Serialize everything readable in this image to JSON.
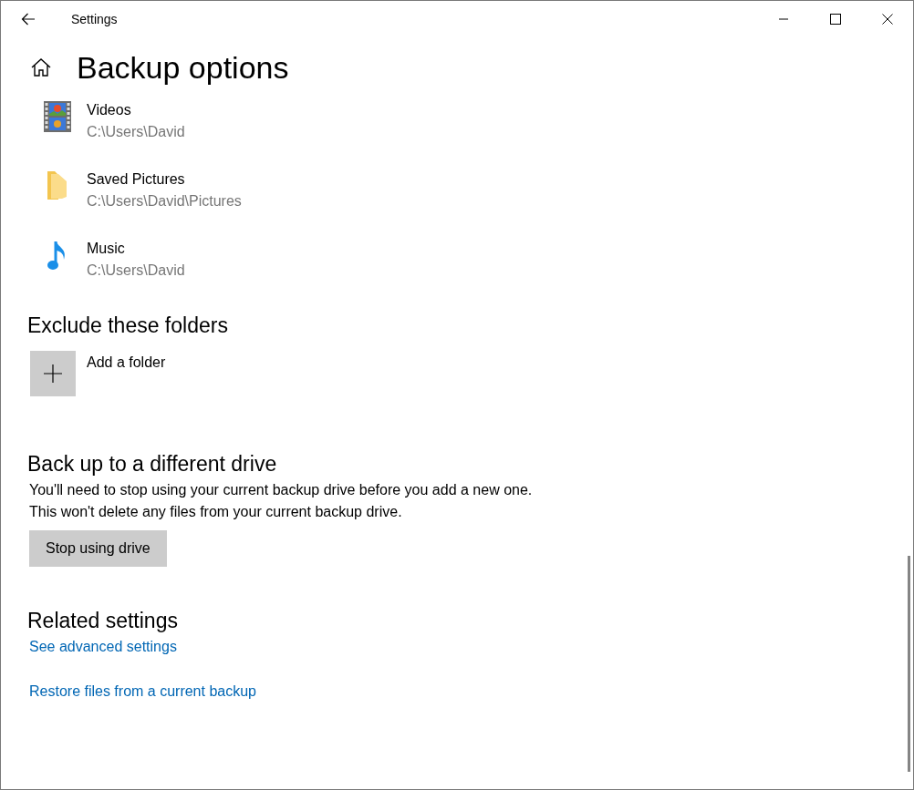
{
  "window": {
    "title": "Settings"
  },
  "page_title": "Backup options",
  "folders": [
    {
      "kind": "videos",
      "name": "Videos",
      "path": "C:\\Users\\David"
    },
    {
      "kind": "folder",
      "name": "Saved Pictures",
      "path": "C:\\Users\\David\\Pictures"
    },
    {
      "kind": "music",
      "name": "Music",
      "path": "C:\\Users\\David"
    }
  ],
  "exclude": {
    "heading": "Exclude these folders",
    "add_label": "Add a folder"
  },
  "different_drive": {
    "heading": "Back up to a different drive",
    "description": "You'll need to stop using your current backup drive before you add a new one. This won't delete any files from your current backup drive.",
    "button": "Stop using drive"
  },
  "related": {
    "heading": "Related settings",
    "links": [
      "See advanced settings",
      "Restore files from a current backup"
    ]
  }
}
